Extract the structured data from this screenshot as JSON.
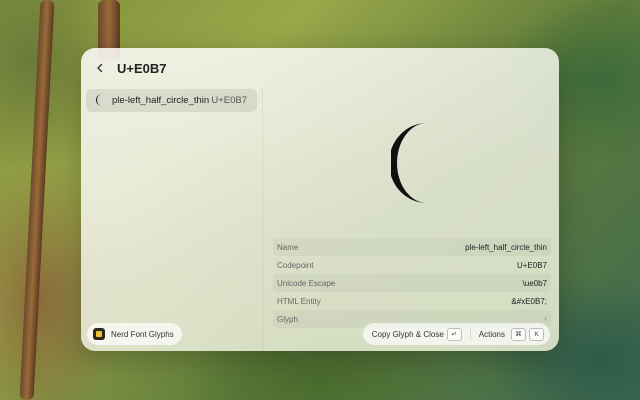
{
  "window": {
    "title": "U+E0B7"
  },
  "list": {
    "items": [
      {
        "glyph": "(",
        "name": "ple-left_half_circle_thin",
        "codepoint": "U+E0B7",
        "selected": true
      }
    ]
  },
  "preview": {
    "glyph": "("
  },
  "details": [
    {
      "key": "Name",
      "value": "ple-left_half_circle_thin"
    },
    {
      "key": "Codepoint",
      "value": "U+E0B7"
    },
    {
      "key": "Unicode Escape",
      "value": "\\ue0b7"
    },
    {
      "key": "HTML Entity",
      "value": "&#xE0B7;"
    },
    {
      "key": "Glyph",
      "value": ""
    }
  ],
  "footer": {
    "extension_name": "Nerd Font Glyphs",
    "primary_action": "Copy Glyph & Close",
    "primary_shortcut": "↵",
    "actions_label": "Actions",
    "actions_shortcut_1": "⌘",
    "actions_shortcut_2": "K"
  },
  "icons": {
    "back": "chevron-left-icon",
    "extension": "nerd-font-extension-icon"
  }
}
